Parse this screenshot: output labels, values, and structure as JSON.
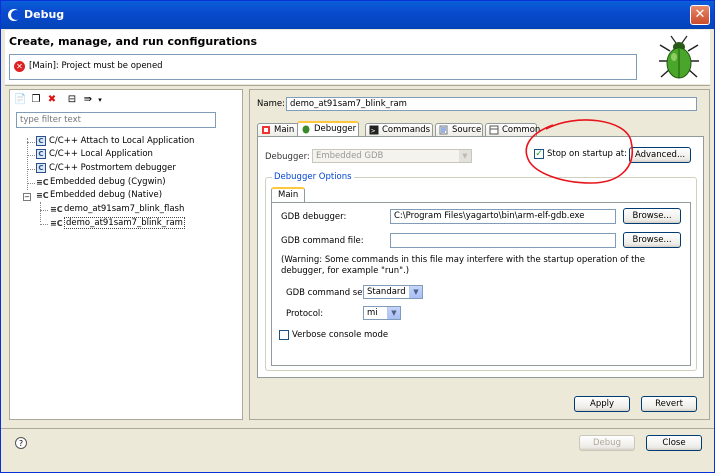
{
  "window": {
    "title": "Debug"
  },
  "header": {
    "heading": "Create, manage, and run configurations",
    "message": "[Main]: Project must be opened"
  },
  "left": {
    "filter_placeholder": "type filter text",
    "tree": [
      {
        "label": "C/C++ Attach to Local Application"
      },
      {
        "label": "C/C++ Local Application"
      },
      {
        "label": "C/C++ Postmortem debugger"
      },
      {
        "label": "Embedded debug (Cygwin)"
      },
      {
        "label": "Embedded debug (Native)"
      },
      {
        "label": "demo_at91sam7_blink_flash"
      },
      {
        "label": "demo_at91sam7_blink_ram"
      }
    ]
  },
  "right": {
    "name_label": "Name:",
    "name_value": "demo_at91sam7_blink_ram",
    "tabs": [
      {
        "label": "Main"
      },
      {
        "label": "Debugger"
      },
      {
        "label": "Commands"
      },
      {
        "label": "Source"
      },
      {
        "label": "Common"
      }
    ],
    "debugger_label": "Debugger:",
    "debugger_value": "Embedded GDB",
    "stop_on_startup_label": "Stop on startup at:",
    "advanced_label": "Advanced...",
    "options_title": "Debugger Options",
    "inner_tab": "Main",
    "gdb_debugger_label": "GDB debugger:",
    "gdb_debugger_value": "C:\\Program Files\\yagarto\\bin\\arm-elf-gdb.exe",
    "browse_label": "Browse...",
    "gdb_command_file_label": "GDB command file:",
    "gdb_command_file_value": "",
    "warning": "(Warning: Some commands in this file may interfere with the startup operation of the debugger, for example \"run\".)",
    "command_set_label": "GDB command set:",
    "command_set_value": "Standard",
    "protocol_label": "Protocol:",
    "protocol_value": "mi",
    "verbose_label": "Verbose console mode",
    "apply_label": "Apply",
    "revert_label": "Revert"
  },
  "footer": {
    "debug_label": "Debug",
    "close_label": "Close"
  },
  "colors": {
    "titlebar": "#0a4bcf",
    "annotation": "#e8141b",
    "active_tab_accent": "#ffc83c"
  }
}
